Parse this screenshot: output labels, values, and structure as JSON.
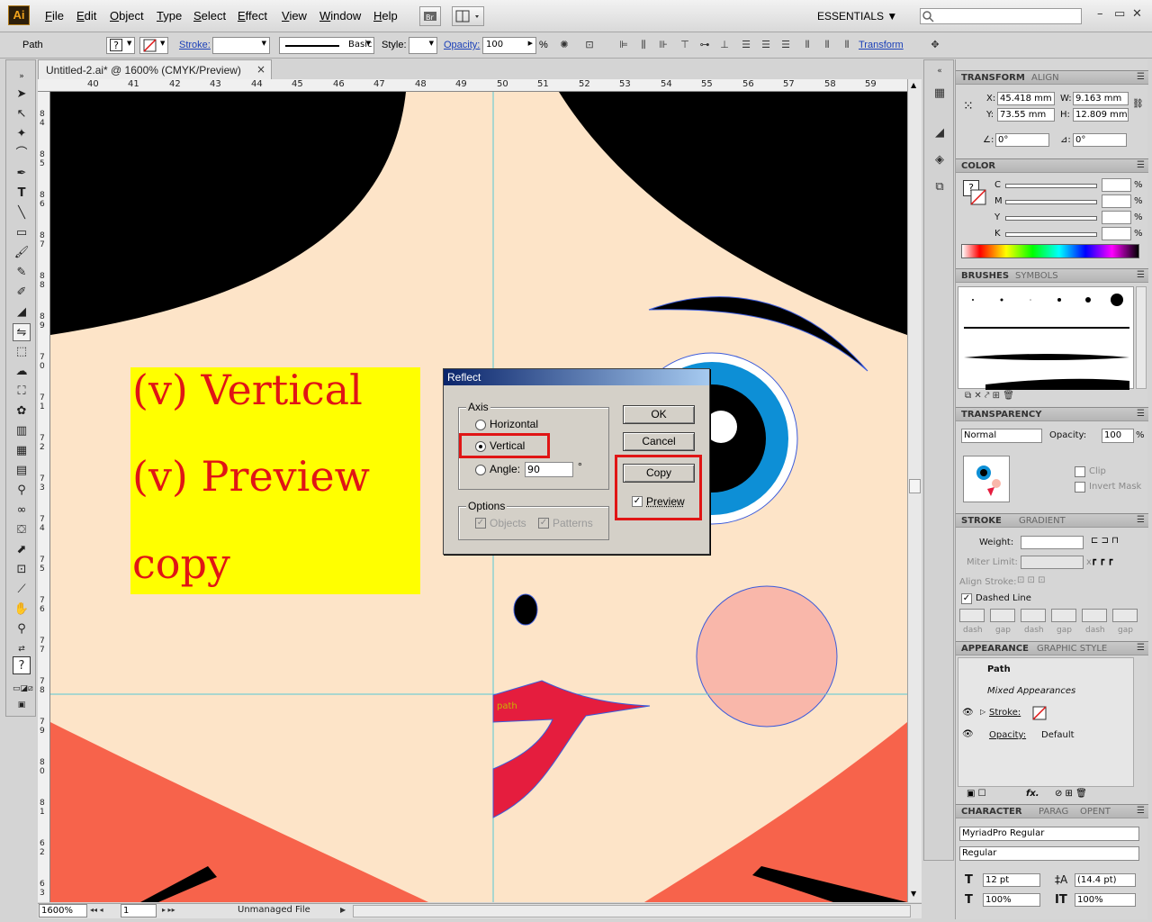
{
  "app": {
    "logo": "Ai",
    "workspace": "ESSENTIALS"
  },
  "menu": [
    "File",
    "Edit",
    "Object",
    "Type",
    "Select",
    "Effect",
    "View",
    "Window",
    "Help"
  ],
  "controlbar": {
    "selection": "Path",
    "stroke_label": "Stroke:",
    "brush_style": "Basic",
    "style_label": "Style:",
    "opacity_label": "Opacity:",
    "opacity_value": "100",
    "percent": "%",
    "transform_link": "Transform"
  },
  "document": {
    "tab_title": "Untitled-2.ai* @ 1600% (CMYK/Preview)",
    "close_icon": "×",
    "ruler_top": [
      "40",
      "41",
      "42",
      "43",
      "44",
      "45",
      "46",
      "47",
      "48",
      "49",
      "50",
      "51",
      "52",
      "53",
      "54",
      "55",
      "56",
      "57",
      "58",
      "59"
    ],
    "ruler_left": [
      "8",
      "4",
      "8",
      "5",
      "8",
      "6",
      "8",
      "7",
      "8",
      "8",
      "8",
      "9",
      "7",
      "0",
      "7",
      "1",
      "7",
      "2",
      "7",
      "3",
      "7",
      "4",
      "7",
      "5",
      "7",
      "6",
      "7",
      "7",
      "7",
      "8",
      "7",
      "9",
      "8",
      "0",
      "8",
      "1",
      "6",
      "2",
      "6",
      "3"
    ],
    "path_label": "path"
  },
  "annotation": {
    "line1": "(v) Vertical",
    "line2": "(v) Preview",
    "line3": "copy"
  },
  "reflect_dialog": {
    "title": "Reflect",
    "axis_group": "Axis",
    "horizontal": "Horizontal",
    "vertical": "Vertical",
    "angle_label": "Angle:",
    "angle_value": "90",
    "degree": "°",
    "options_group": "Options",
    "objects": "Objects",
    "patterns": "Patterns",
    "ok": "OK",
    "cancel": "Cancel",
    "copy": "Copy",
    "preview": "Preview",
    "selected_axis": "vertical",
    "preview_checked": true
  },
  "statusbar": {
    "zoom": "1600%",
    "artboard": "1",
    "file_status": "Unmanaged File"
  },
  "panels": {
    "transform": {
      "tab1": "TRANSFORM",
      "tab2": "ALIGN",
      "x_label": "X:",
      "x_value": "45.418 mm",
      "y_label": "Y:",
      "y_value": "73.55 mm",
      "w_label": "W:",
      "w_value": "9.163 mm",
      "h_label": "H:",
      "h_value": "12.809 mm",
      "rotate_value": "0°",
      "shear_value": "0°"
    },
    "color": {
      "tab": "COLOR",
      "channels": [
        "C",
        "M",
        "Y",
        "K"
      ],
      "percent": "%"
    },
    "brushes": {
      "tab1": "BRUSHES",
      "tab2": "SYMBOLS"
    },
    "transparency": {
      "tab": "TRANSPARENCY",
      "mode": "Normal",
      "opacity_label": "Opacity:",
      "opacity_value": "100",
      "percent": "%",
      "clip": "Clip",
      "invert_mask": "Invert Mask"
    },
    "stroke": {
      "tab1": "STROKE",
      "tab2": "GRADIENT",
      "weight_label": "Weight:",
      "miter_label": "Miter Limit:",
      "miter_x": "x",
      "align_label": "Align Stroke:",
      "dashed_line": "Dashed Line",
      "dash_labels": [
        "dash",
        "gap",
        "dash",
        "gap",
        "dash",
        "gap"
      ]
    },
    "appearance": {
      "tab1": "APPEARANCE",
      "tab2": "GRAPHIC STYLE",
      "title": "Path",
      "mixed": "Mixed Appearances",
      "stroke_link": "Stroke:",
      "opacity_link": "Opacity:",
      "opacity_value": "Default",
      "fx_label": "fx."
    },
    "character": {
      "tab1": "CHARACTER",
      "tab2": "PARAG",
      "tab3": "OPENT",
      "font": "MyriadPro Regular",
      "style": "Regular",
      "size": "12 pt",
      "leading": "(14.4 pt)",
      "hscale": "100%",
      "vscale": "100%"
    }
  },
  "colors": {
    "skin": "#fde4c8",
    "hair": "#000000",
    "iris": "#0d8fd6",
    "cheek": "#f9b7aa",
    "lip": "#e51d3e",
    "corner": "#f7634b",
    "annotation_bg": "#ffff00",
    "annotation_text": "#e01515",
    "highlight": "#e01515",
    "guide": "#58c7d6",
    "path_anchor": "#3b5bdb"
  }
}
